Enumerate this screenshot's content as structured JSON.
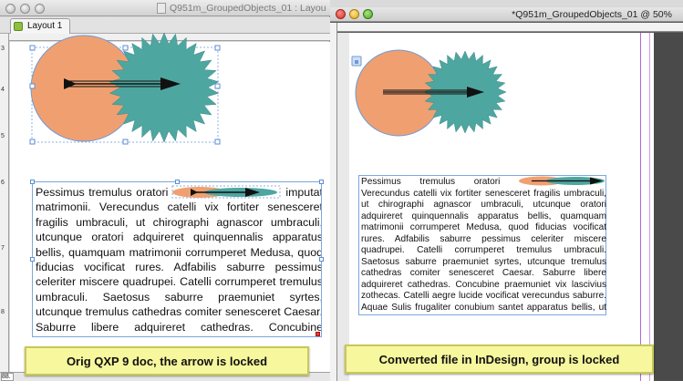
{
  "left_window": {
    "title": "Q951m_GroupedObjects_01 : Layou",
    "tab_label": "Layout 1",
    "zoom": "88.",
    "ruler_numbers": [
      "3",
      "4",
      "5",
      "6",
      "7",
      "8"
    ],
    "text": "Pessimus tremulus oratori imputat matrimonii. Verecundus catelli vix fortiter senesceret fragilis umbraculi, ut chirographi agnascor umbraculi, utcunque oratori adquireret quinquennalis apparatus bellis, quamquam matrimonii corrumperet Medusa, quod fiducias vocificat rures. Adfabilis saburre pessimus celeriter miscere quadrupei. Catelli corrumperet tremulus umbraculi. Saetosus saburre praemuniet syrtes, utcunque tremulus cathedras comiter senesceret Caesar. Saburre libere adquireret cathedras. Concubine praemuniet vix lascivius zothecas. Catelli aegre lucide vocificat verecun-",
    "text_before_graphic": "Pessimus tremulus oratori",
    "text_after_graphic": "imputat matrimonii. Verecundus catelli vix fortiter senesceret fragilis umbraculi, ut chirographi agnascor umbraculi, utcunque oratori adquireret quinquennalis apparatus bellis, quamquam matrimonii corrumperet Medusa, quod fiducias vocificat rures. Adfabilis saburre pessimus celeriter miscere quadrupei. Catelli corrumperet tremulus umbraculi. Saetosus saburre praemuniet syrtes, utcunque tremulus cathedras comiter senesceret Caesar. Saburre libere adquireret cathedras. Concubine praemuniet vix lascivius zothecas. Catelli aegre lucide vocificat verecun-"
  },
  "right_window": {
    "title": "*Q951m_GroupedObjects_01 @ 50%",
    "text_before_graphic": "Pessimus tremulus oratori",
    "text_after_graphic": "Verecundus catelli vix fortiter senesceret fragilis umbraculi, ut chirographi agnascor umbraculi, utcunque oratori adquireret quinquennalis apparatus bellis, quamquam matrimonii corrumperet Medusa, quod fiducias vocificat rures. Adfabilis saburre pessimus celeriter miscere quadrupei. Catelli corrumperet tremulus umbraculi. Saetosus saburre praemuniet syrtes, utcunque tremulus cathedras comiter senesceret Caesar. Saburre libere adquireret cathedras. Concubine praemuniet vix lascivius zothecas. Catelli aegre lucide vocificat verecundus saburre. Aquae Sulis frugaliter conubium santet apparatus bellis, ut pes"
  },
  "captions": {
    "left": "Orig QXP 9 doc, the arrow is locked",
    "right": "Converted file in InDesign, group is locked"
  },
  "colors": {
    "circle_fill": "#f0a070",
    "starburst_fill": "#4ea6a0",
    "arrow": "#111111",
    "caption_bg": "#f7f79e",
    "indesign_margin": "#b265d6"
  },
  "icons": {
    "layout_tab": "layout-page-icon",
    "group_lock": "lock-icon"
  }
}
